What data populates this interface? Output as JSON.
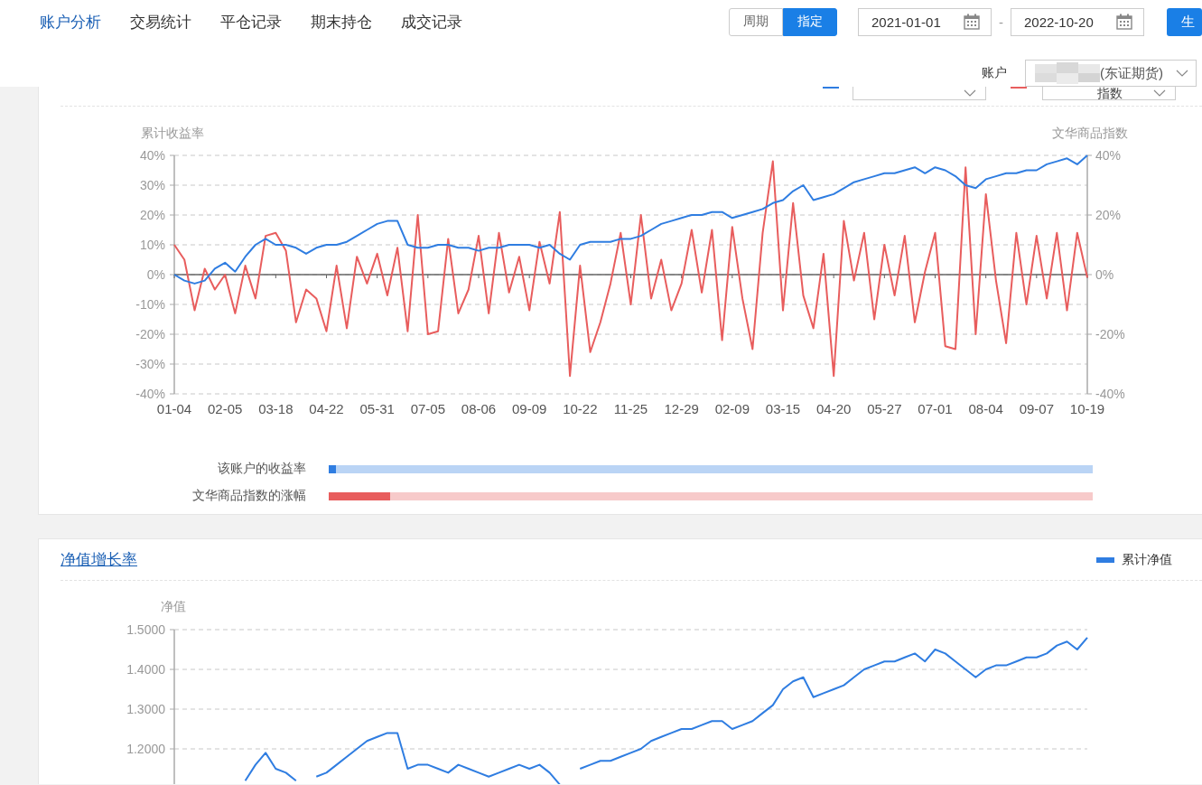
{
  "nav_tabs": [
    {
      "label": "账户分析",
      "selected": true
    },
    {
      "label": "交易统计",
      "selected": false
    },
    {
      "label": "平仓记录",
      "selected": false
    },
    {
      "label": "期末持仓",
      "selected": false
    },
    {
      "label": "成交记录",
      "selected": false
    }
  ],
  "period_toggle": [
    {
      "label": "周期",
      "selected": false
    },
    {
      "label": "指定",
      "selected": true
    }
  ],
  "date_range": {
    "start": "2021-01-01",
    "separator": "-",
    "end": "2022-10-20"
  },
  "generate_button": "生",
  "account": {
    "label": "账户",
    "value": "(东证期货)"
  },
  "returns_card": {
    "legend": [
      {
        "color": "#2f7de1"
      },
      {
        "color": "#e85d5d",
        "value": "指数"
      }
    ],
    "chart_data": {
      "type": "line",
      "grid": true,
      "ylabel": "累计收益率",
      "y2label": "文华商品指数",
      "ylim": [
        -40,
        40
      ],
      "y2lim": [
        -40,
        40
      ],
      "categories": [
        "01-04",
        null,
        null,
        null,
        null,
        "02-05",
        null,
        null,
        null,
        null,
        "03-18",
        null,
        null,
        null,
        null,
        "04-22",
        null,
        null,
        null,
        null,
        "05-31",
        null,
        null,
        null,
        null,
        "07-05",
        null,
        null,
        null,
        null,
        "08-06",
        null,
        null,
        null,
        null,
        "09-09",
        null,
        null,
        null,
        null,
        "10-22",
        null,
        null,
        null,
        null,
        "11-25",
        null,
        null,
        null,
        null,
        "12-29",
        null,
        null,
        null,
        null,
        "02-09",
        null,
        null,
        null,
        null,
        "03-15",
        null,
        null,
        null,
        null,
        "04-20",
        null,
        null,
        null,
        null,
        "05-27",
        null,
        null,
        null,
        null,
        "07-01",
        null,
        null,
        null,
        null,
        "08-04",
        null,
        null,
        null,
        null,
        "09-07",
        null,
        null,
        null,
        null,
        "10-19"
      ],
      "yticks": [
        {
          "value": 40,
          "label": "40%"
        },
        {
          "value": 30,
          "label": "30%"
        },
        {
          "value": 20,
          "label": "20%"
        },
        {
          "value": 10,
          "label": "10%"
        },
        {
          "value": 0,
          "label": "0%"
        },
        {
          "value": -10,
          "label": "-10%"
        },
        {
          "value": -20,
          "label": "-20%"
        },
        {
          "value": -30,
          "label": "-30%"
        },
        {
          "value": -40,
          "label": "-40%"
        }
      ],
      "y2ticks": [
        {
          "value": 40,
          "label": "40%"
        },
        {
          "value": 20,
          "label": "20%"
        },
        {
          "value": 0,
          "label": "0%"
        },
        {
          "value": -20,
          "label": "-20%"
        },
        {
          "value": -40,
          "label": "-40%"
        }
      ],
      "series": [
        {
          "color": "#2f7de1",
          "values": [
            0,
            -2,
            -3,
            -2,
            2,
            4,
            1,
            6,
            10,
            12,
            10,
            10,
            9,
            7,
            9,
            10,
            10,
            11,
            13,
            15,
            17,
            18,
            18,
            10,
            9,
            9,
            10,
            10,
            9,
            9,
            8,
            9,
            9,
            10,
            10,
            10,
            9,
            10,
            7,
            5,
            10,
            11,
            11,
            11,
            12,
            12,
            13,
            15,
            17,
            18,
            19,
            20,
            20,
            21,
            21,
            19,
            20,
            21,
            22,
            24,
            25,
            28,
            30,
            25,
            26,
            27,
            29,
            31,
            32,
            33,
            34,
            34,
            35,
            36,
            34,
            36,
            35,
            33,
            30,
            29,
            32,
            33,
            34,
            34,
            35,
            35,
            37,
            38,
            39,
            37,
            40
          ]
        },
        {
          "axis": "y2",
          "color": "#e85d5d",
          "values": [
            10,
            5,
            -12,
            2,
            -5,
            0,
            -13,
            3,
            -8,
            13,
            14,
            8,
            -16,
            -5,
            -8,
            -19,
            3,
            -18,
            6,
            -3,
            7,
            -7,
            9,
            -19,
            20,
            -20,
            -19,
            12,
            -13,
            -5,
            13,
            -13,
            14,
            -6,
            6,
            -12,
            11,
            -3,
            21,
            -34,
            3,
            -26,
            -16,
            -3,
            14,
            -10,
            20,
            -8,
            5,
            -12,
            -3,
            15,
            -6,
            15,
            -22,
            16,
            -8,
            -25,
            14,
            38,
            -12,
            24,
            -7,
            -18,
            7,
            -34,
            18,
            -2,
            14,
            -15,
            10,
            -7,
            13,
            -16,
            1,
            14,
            -24,
            -25,
            36,
            -20,
            27,
            -2,
            -23,
            14,
            -10,
            13,
            -8,
            14,
            -12,
            14,
            -1
          ]
        }
      ]
    },
    "comparison": [
      {
        "label": "该账户的收益率",
        "level": 0.01,
        "color": "#2f7de1"
      },
      {
        "label": "文华商品指数的涨幅",
        "level": 0.08,
        "color": "#e85d5d"
      }
    ]
  },
  "net_value_card": {
    "title": "净值增长率",
    "chart_data": {
      "type": "line",
      "grid": true,
      "ylabel": "净值",
      "ylim": [
        1.1,
        1.5
      ],
      "yticks": [
        {
          "value": 1.5,
          "label": "1.5000"
        },
        {
          "value": 1.4,
          "label": "1.4000"
        },
        {
          "value": 1.3,
          "label": "1.3000"
        },
        {
          "value": 1.2,
          "label": "1.2000"
        }
      ],
      "series": [
        {
          "name": "累计净值",
          "color": "#2f7de1",
          "values": [
            null,
            null,
            null,
            null,
            null,
            null,
            null,
            1.12,
            1.16,
            1.19,
            1.15,
            1.14,
            1.12,
            null,
            1.13,
            1.14,
            1.16,
            1.18,
            1.2,
            1.22,
            1.23,
            1.24,
            1.24,
            1.15,
            1.16,
            1.16,
            1.15,
            1.14,
            1.16,
            1.15,
            1.14,
            1.13,
            1.14,
            1.15,
            1.16,
            1.15,
            1.16,
            1.14,
            1.11,
            null,
            1.15,
            1.16,
            1.17,
            1.17,
            1.18,
            1.19,
            1.2,
            1.22,
            1.23,
            1.24,
            1.25,
            1.25,
            1.26,
            1.27,
            1.27,
            1.25,
            1.26,
            1.27,
            1.29,
            1.31,
            1.35,
            1.37,
            1.38,
            1.33,
            1.34,
            1.35,
            1.36,
            1.38,
            1.4,
            1.41,
            1.42,
            1.42,
            1.43,
            1.44,
            1.42,
            1.45,
            1.44,
            1.42,
            1.4,
            1.38,
            1.4,
            1.41,
            1.41,
            1.42,
            1.43,
            1.43,
            1.44,
            1.46,
            1.47,
            1.45,
            1.48
          ]
        }
      ]
    }
  }
}
